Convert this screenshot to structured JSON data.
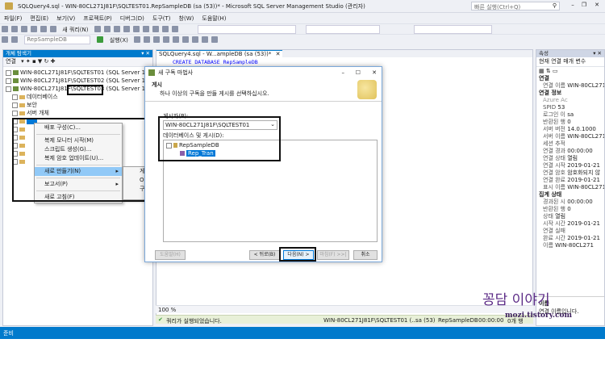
{
  "window": {
    "title": "SQLQuery4.sql - WIN-80CL271J81F\\SQLTEST01.RepSampleDB (sa (53))* - Microsoft SQL Server Management Studio (관리자)",
    "quick_launch_placeholder": "빠른 실행(Ctrl+Q)"
  },
  "menu": [
    "파일(F)",
    "편집(E)",
    "보기(V)",
    "프로젝트(P)",
    "디버그(D)",
    "도구(T)",
    "창(W)",
    "도움말(H)"
  ],
  "toolbar": {
    "new_query": "새 쿼리(N)",
    "db_selector": "RepSampleDB",
    "execute": "실행(X)"
  },
  "object_explorer": {
    "title": "개체 탐색기",
    "connect": "연결",
    "servers": [
      "WIN-80CL271J81F\\SQLTEST01 (SQL Server 14.0.1000 - sa)",
      "WIN-80CL271J81F\\SQLTEST02 (SQL Server 14.0.1000 - sa)",
      "WIN-80CL271J81F\\SQLTEST03 (SQL Server 14.0.1000 - sa)"
    ],
    "highlight_server": "WIN-80CL271J81F\\SQLTEST03",
    "children": [
      "데이터베이스",
      "보안",
      "서버 개체",
      "복제"
    ]
  },
  "context_menu": {
    "items": [
      "배포 구성(C)...",
      "복제 모니터 시작(M)",
      "스크립트 생성(G)...",
      "복제 암호 업데이트(U)...",
      "새로 만들기(N)",
      "보고서(P)",
      "새로 고침(F)"
    ],
    "submenu_fragments": [
      "게",
      "Or",
      "구"
    ]
  },
  "editor": {
    "tab": "SQLQuery4.sql - W...ampleDB (sa (53))*",
    "code": "CREATE DATABASE RepSampleDB",
    "zoom": "100 %",
    "status_ok": "쿼리가 실행되었습니다.",
    "status_server": "WIN-80CL271J81F\\SQLTEST01 (...",
    "status_user": "sa (53)",
    "status_db": "RepSampleDB",
    "status_time": "00:00:00",
    "status_rows": "0개 행"
  },
  "wizard": {
    "title": "새 구독 마법사",
    "heading": "게시",
    "subtitle": "하나 이상의 구독을 만들 게시를 선택하십시오.",
    "publisher_label": "게시자(P):",
    "publisher_value": "WIN-80CL271J81F\\SQLTEST01",
    "db_label": "데이터베이스 및 게시(D):",
    "db_name": "RepSampleDB",
    "publication": "Rep_Tran",
    "buttons": {
      "help": "도움말(H)",
      "back": "< 뒤로(B)",
      "next": "다음(N) >",
      "finish": "마침(F) >>|",
      "cancel": "취소"
    }
  },
  "properties": {
    "title": "속성",
    "selector": "현재 연결 매개 변수",
    "sections": {
      "connection": "연결",
      "connection_info": "연결 정보",
      "aggregate": "집계 상태"
    },
    "rows": [
      [
        "연결 이름",
        "WIN-80CL271"
      ],
      [
        "Azure Ac",
        ""
      ],
      [
        "SPID",
        "53"
      ],
      [
        "로그인 이",
        "sa"
      ],
      [
        "반환된 행",
        "0"
      ],
      [
        "서버 버전",
        "14.0.1000"
      ],
      [
        "서버 이름",
        "WIN-80CL271"
      ],
      [
        "세션 추적",
        ""
      ],
      [
        "연결 경과",
        "00:00:00"
      ],
      [
        "연결 상태",
        "열림"
      ],
      [
        "연결 시작",
        "2019-01-21"
      ],
      [
        "연결 암호",
        "암호화되지 않"
      ],
      [
        "연결 완료",
        "2019-01-21"
      ],
      [
        "표시 이름",
        "WIN-80CL271"
      ],
      [
        "경과된 시",
        "00:00:00"
      ],
      [
        "반환된 행",
        "0"
      ],
      [
        "상태",
        "열림"
      ],
      [
        "시작 시간",
        "2019-01-21"
      ],
      [
        "연결 실패",
        ""
      ],
      [
        "완료 시간",
        "2019-01-21"
      ],
      [
        "이름",
        "WIN-80CL271"
      ]
    ],
    "footer_name": "이름",
    "footer_desc": "연결 이름입니다."
  },
  "statusbar": {
    "ready": "준비"
  },
  "watermark": {
    "title": "꽁담 이야기",
    "url": "mozi.tistory.com"
  }
}
